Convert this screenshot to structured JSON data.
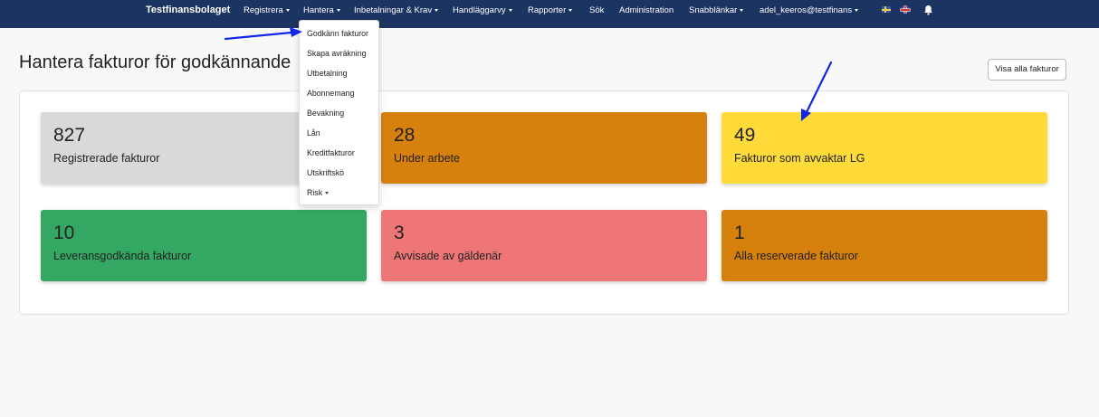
{
  "navbar": {
    "brand": "Testfinansbolaget",
    "items": [
      {
        "label": "Registrera",
        "dropdown": true
      },
      {
        "label": "Hantera",
        "dropdown": true
      },
      {
        "label": "Inbetalningar & Krav",
        "dropdown": true
      },
      {
        "label": "Handläggarvy",
        "dropdown": true
      },
      {
        "label": "Rapporter",
        "dropdown": true
      },
      {
        "label": "Sök",
        "dropdown": false
      },
      {
        "label": "Administration",
        "dropdown": false
      },
      {
        "label": "Snabblänkar",
        "dropdown": true
      },
      {
        "label": "adel_keeros@testfinans",
        "dropdown": true
      }
    ],
    "flags": [
      "flag-se-icon",
      "flag-gb-icon"
    ],
    "bell_icon": "bell-icon"
  },
  "hantera_menu": {
    "items": [
      {
        "label": "Godkänn fakturor",
        "dropdown": false
      },
      {
        "label": "Skapa avräkning",
        "dropdown": false
      },
      {
        "label": "Utbetalning",
        "dropdown": false
      },
      {
        "label": "Abonnemang",
        "dropdown": false
      },
      {
        "label": "Bevakning",
        "dropdown": false
      },
      {
        "label": "Lån",
        "dropdown": false
      },
      {
        "label": "Kreditfakturor",
        "dropdown": false
      },
      {
        "label": "Utskriftskö",
        "dropdown": false
      },
      {
        "label": "Risk",
        "dropdown": true
      }
    ]
  },
  "page": {
    "title": "Hantera fakturor för godkännande",
    "show_all_button": "Visa alla fakturor"
  },
  "cards": [
    {
      "count": "827",
      "label": "Registrerade fakturor",
      "color": "#d9d9d9"
    },
    {
      "count": "28",
      "label": "Under arbete",
      "color": "#d6800e"
    },
    {
      "count": "49",
      "label": "Fakturor som avvaktar LG",
      "color": "#ffdb3a"
    },
    {
      "count": "10",
      "label": "Leveransgodkända fakturor",
      "color": "#34a862"
    },
    {
      "count": "3",
      "label": "Avvisade av gäldenär",
      "color": "#ee7677"
    },
    {
      "count": "1",
      "label": "Alla reserverade fakturor",
      "color": "#d6800e"
    }
  ],
  "annotations": {
    "arrow_color": "#1026e6"
  }
}
